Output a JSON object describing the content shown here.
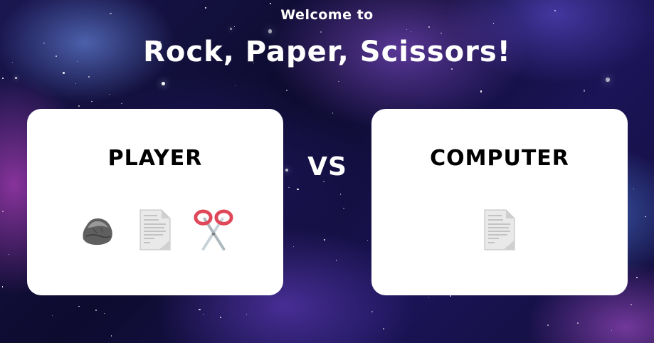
{
  "header": {
    "welcome": "Welcome to",
    "title": "Rock, Paper, Scissors!"
  },
  "player": {
    "label": "PLAYER",
    "choices": [
      {
        "name": "rock",
        "icon": "rock-icon"
      },
      {
        "name": "paper",
        "icon": "paper-icon"
      },
      {
        "name": "scissors",
        "icon": "scissors-icon"
      }
    ]
  },
  "versus": "VS",
  "computer": {
    "label": "COMPUTER",
    "choice": {
      "name": "paper",
      "icon": "paper-icon"
    }
  },
  "colors": {
    "card_bg": "#ffffff",
    "text_light": "#ffffff",
    "text_dark": "#000000"
  }
}
